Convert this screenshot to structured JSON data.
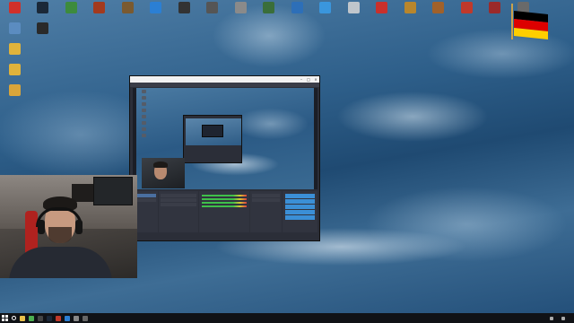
{
  "desktop_icons": [
    {
      "label": "",
      "color": "#d0302a",
      "col": 0,
      "row": 0
    },
    {
      "label": "",
      "color": "#1b2838",
      "col": 1,
      "row": 0
    },
    {
      "label": "",
      "color": "#3d8b3d",
      "col": 2,
      "row": 0
    },
    {
      "label": "",
      "color": "#a33a1e",
      "col": 3,
      "row": 0
    },
    {
      "label": "",
      "color": "#7a5a30",
      "col": 4,
      "row": 0
    },
    {
      "label": "",
      "color": "#2b7fd4",
      "col": 5,
      "row": 0
    },
    {
      "label": "",
      "color": "#333333",
      "col": 6,
      "row": 0
    },
    {
      "label": "",
      "color": "#555555",
      "col": 7,
      "row": 0
    },
    {
      "label": "",
      "color": "#8a8a8a",
      "col": 8,
      "row": 0
    },
    {
      "label": "",
      "color": "#3a6e3a",
      "col": 9,
      "row": 0
    },
    {
      "label": "",
      "color": "#2d6fb8",
      "col": 10,
      "row": 0
    },
    {
      "label": "",
      "color": "#3a96dd",
      "col": 11,
      "row": 0
    },
    {
      "label": "",
      "color": "#c0c6cc",
      "col": 12,
      "row": 0
    },
    {
      "label": "",
      "color": "#c9302c",
      "col": 13,
      "row": 0
    },
    {
      "label": "",
      "color": "#b8862c",
      "col": 14,
      "row": 0
    },
    {
      "label": "",
      "color": "#a0612a",
      "col": 15,
      "row": 0
    },
    {
      "label": "",
      "color": "#c0392b",
      "col": 16,
      "row": 0
    },
    {
      "label": "",
      "color": "#9b2a2a",
      "col": 17,
      "row": 0
    },
    {
      "label": "",
      "color": "#6a6a6a",
      "col": 18,
      "row": 0
    },
    {
      "label": "",
      "color": "#5b8cc0",
      "col": 0,
      "row": 1
    },
    {
      "label": "",
      "color": "#2a2a2a",
      "col": 1,
      "row": 1
    },
    {
      "label": "",
      "color": "#e0b33b",
      "col": 0,
      "row": 2
    },
    {
      "label": "",
      "color": "#e0b33b",
      "col": 0,
      "row": 3
    },
    {
      "label": "",
      "color": "#d9a53a",
      "col": 0,
      "row": 4
    }
  ],
  "flag_colors": [
    "#000000",
    "#dd0000",
    "#ffce00"
  ],
  "obs_window": {
    "title": "",
    "menu": [
      "",
      "",
      "",
      "",
      "",
      "",
      ""
    ],
    "docks": [
      "",
      "",
      "",
      "",
      "",
      ""
    ],
    "controls": [
      "",
      "",
      "",
      "",
      "",
      ""
    ],
    "status": [
      "",
      "",
      "",
      ""
    ]
  },
  "taskbar": {
    "time": "",
    "date": "",
    "apps": [
      {
        "icon": "file-explorer-icon",
        "color": "#e8c04a"
      },
      {
        "icon": "chrome-icon",
        "color": "#4caf50"
      },
      {
        "icon": "obs-icon",
        "color": "#444444"
      },
      {
        "icon": "steam-icon",
        "color": "#1b2838"
      },
      {
        "icon": "app-icon",
        "color": "#c0392b"
      },
      {
        "icon": "app-icon",
        "color": "#2b7fd4"
      },
      {
        "icon": "app-icon",
        "color": "#888888"
      },
      {
        "icon": "app-icon",
        "color": "#666666"
      }
    ]
  }
}
